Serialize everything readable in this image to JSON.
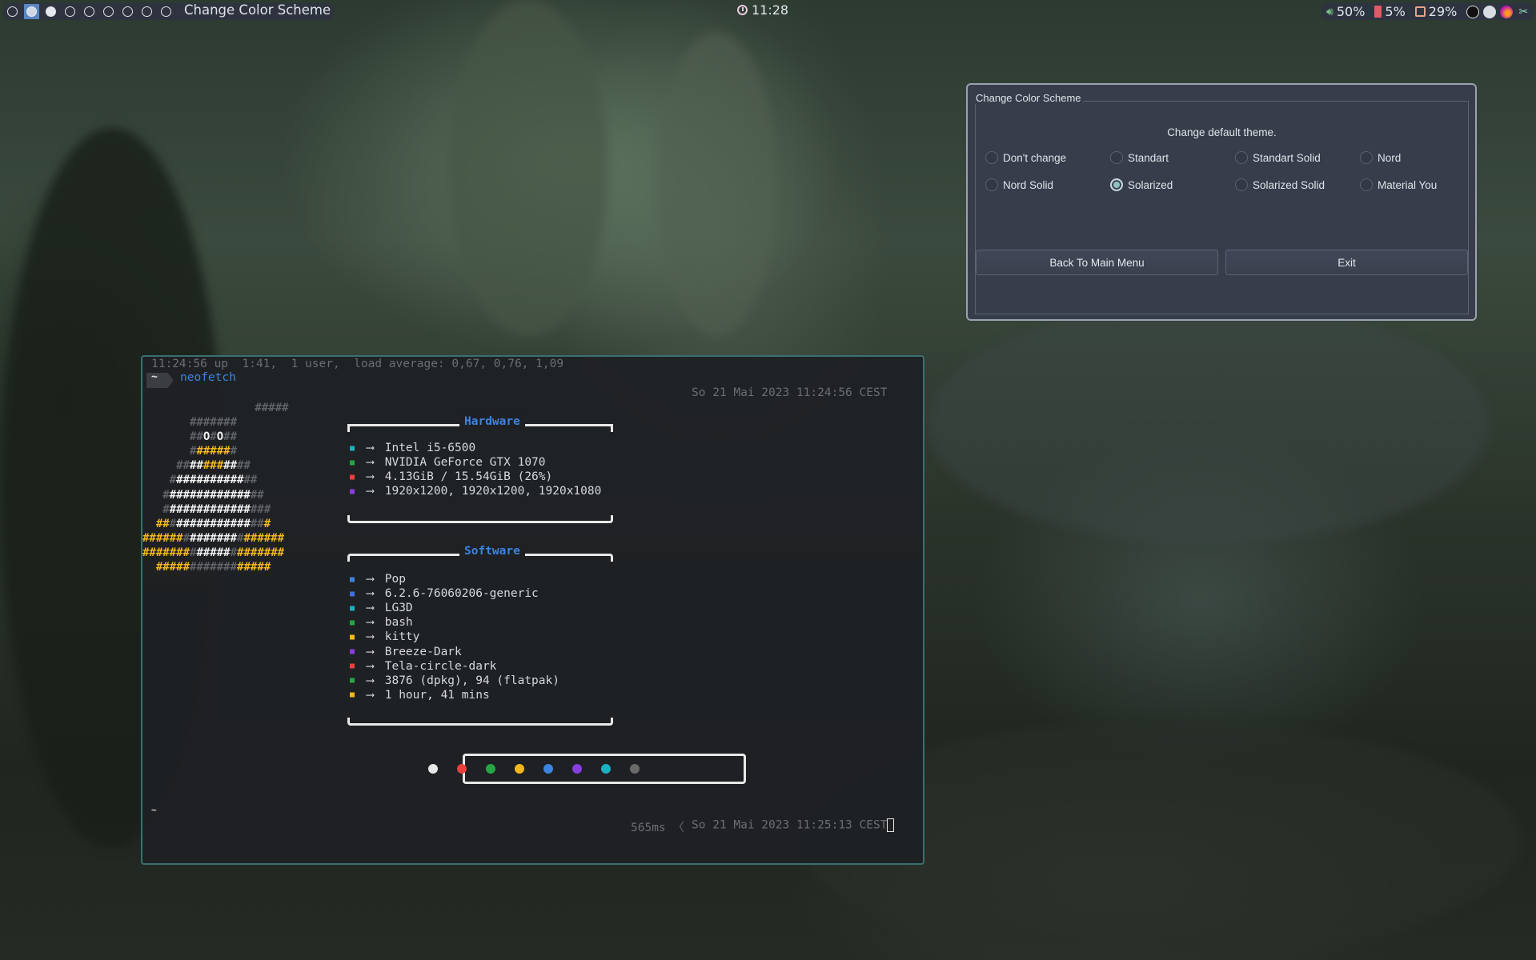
{
  "topbar": {
    "workspaces": [
      {
        "state": "empty"
      },
      {
        "state": "active"
      },
      {
        "state": "occupied"
      },
      {
        "state": "empty"
      },
      {
        "state": "empty"
      },
      {
        "state": "empty"
      },
      {
        "state": "empty"
      },
      {
        "state": "empty"
      },
      {
        "state": "empty"
      }
    ],
    "window_title": "Change Color Scheme",
    "clock": "11:28",
    "tray": {
      "volume": "50%",
      "memory": "5%",
      "disk": "29%",
      "apps": [
        "media-player-icon",
        "steam-icon",
        "flameshot-icon",
        "scissors-icon"
      ]
    }
  },
  "dialog": {
    "group_title": "Change Color Scheme",
    "subtitle": "Change default theme.",
    "options": [
      {
        "label": "Don't change",
        "checked": false
      },
      {
        "label": "Standart",
        "checked": false
      },
      {
        "label": "Standart Solid",
        "checked": false
      },
      {
        "label": "Nord",
        "checked": false
      },
      {
        "label": "Nord Solid",
        "checked": false
      },
      {
        "label": "Solarized",
        "checked": true
      },
      {
        "label": "Solarized Solid",
        "checked": false
      },
      {
        "label": "Material You",
        "checked": false
      }
    ],
    "buttons": {
      "back": "Back To Main Menu",
      "exit": "Exit"
    }
  },
  "terminal": {
    "uptime_line": "11:24:56 up  1:41,  1 user,  load average: 0,67, 0,76, 1,09",
    "prompt_symbol": "~",
    "command": "neofetch",
    "right_timestamp_1": "So 21 Mai 2023 11:24:56 CEST",
    "hardware": {
      "title": "Hardware",
      "rows": [
        {
          "icon": "cpu-icon",
          "color": "#1ab0c0",
          "value": "Intel i5-6500"
        },
        {
          "icon": "gpu-icon",
          "color": "#27a544",
          "value": "NVIDIA GeForce GTX 1070"
        },
        {
          "icon": "memory-icon",
          "color": "#e8413c",
          "value": "4.13GiB / 15.54GiB (26%)"
        },
        {
          "icon": "monitor-icon",
          "color": "#8a3de0",
          "value": "1920x1200, 1920x1200, 1920x1080"
        }
      ]
    },
    "software": {
      "title": "Software",
      "rows": [
        {
          "icon": "distro-icon",
          "color": "#3d84e0",
          "value": "Pop"
        },
        {
          "icon": "linux-icon",
          "color": "#3d6fe0",
          "value": "6.2.6-76060206-generic"
        },
        {
          "icon": "window-manager-icon",
          "color": "#1ab0c0",
          "value": "LG3D"
        },
        {
          "icon": "shell-icon",
          "color": "#27a544",
          "value": "bash"
        },
        {
          "icon": "terminal-icon",
          "color": "#f4b81c",
          "value": "kitty"
        },
        {
          "icon": "paint-roller-icon",
          "color": "#8a3de0",
          "value": "Breeze-Dark"
        },
        {
          "icon": "icons-grid-icon",
          "color": "#e8413c",
          "value": "Tela-circle-dark"
        },
        {
          "icon": "packages-icon",
          "color": "#27a544",
          "value": "3876 (dpkg), 94 (flatpak)"
        },
        {
          "icon": "uptime-icon",
          "color": "#f4b81c",
          "value": "1 hour, 41 mins"
        }
      ]
    },
    "arrow": "⟶",
    "palette": [
      "#e8e8e8",
      "#e8413c",
      "#27a544",
      "#f4b81c",
      "#3d84e0",
      "#8a3de0",
      "#1ab0c0",
      "#6a6a6a"
    ],
    "bottom_prompt": "~",
    "duration": "565ms",
    "right_timestamp_2": "So 21 Mai 2023 11:25:13 CEST"
  }
}
